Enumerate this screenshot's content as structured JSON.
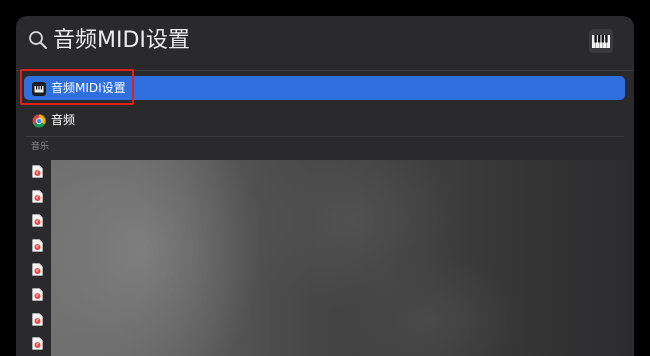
{
  "search": {
    "query": "音频MIDI设置",
    "icon": "search-icon"
  },
  "preview_app_icon": "piano-keyboard-icon",
  "results": [
    {
      "label": "音频MIDI设置",
      "icon": "audio-midi-setup-icon",
      "selected": true
    },
    {
      "label": "音频",
      "icon": "chrome-icon",
      "selected": false
    }
  ],
  "music_section": {
    "header": "音乐",
    "item_icon": "music-file-icon",
    "item_count_visible": 8
  },
  "colors": {
    "selection": "#2f6fde",
    "annotation": "#e0201c",
    "panel": "#2a2a2c"
  }
}
